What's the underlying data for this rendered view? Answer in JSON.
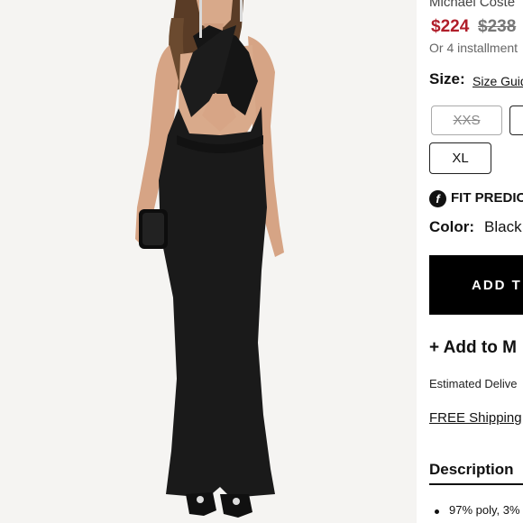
{
  "product": {
    "brand_partial": "Michael Coste",
    "sale_price": "$224",
    "original_price": "$238",
    "installments_partial": "Or 4 installment"
  },
  "size": {
    "label": "Size:",
    "guide_link": "Size Guid",
    "options": [
      "XXS",
      "XL"
    ]
  },
  "fit_predictor": {
    "icon": "fit-predictor-logo",
    "label": "FIT PREDIC"
  },
  "color": {
    "label": "Color:",
    "value": "Black"
  },
  "cart": {
    "add_button_partial": "ADD T"
  },
  "wishlist": {
    "label_partial": "+ Add to M"
  },
  "delivery": {
    "text_partial": "Estimated Delive"
  },
  "shipping": {
    "link_partial": "FREE Shipping"
  },
  "description": {
    "title": "Description",
    "bullet_partial": "97% poly, 3% s"
  }
}
